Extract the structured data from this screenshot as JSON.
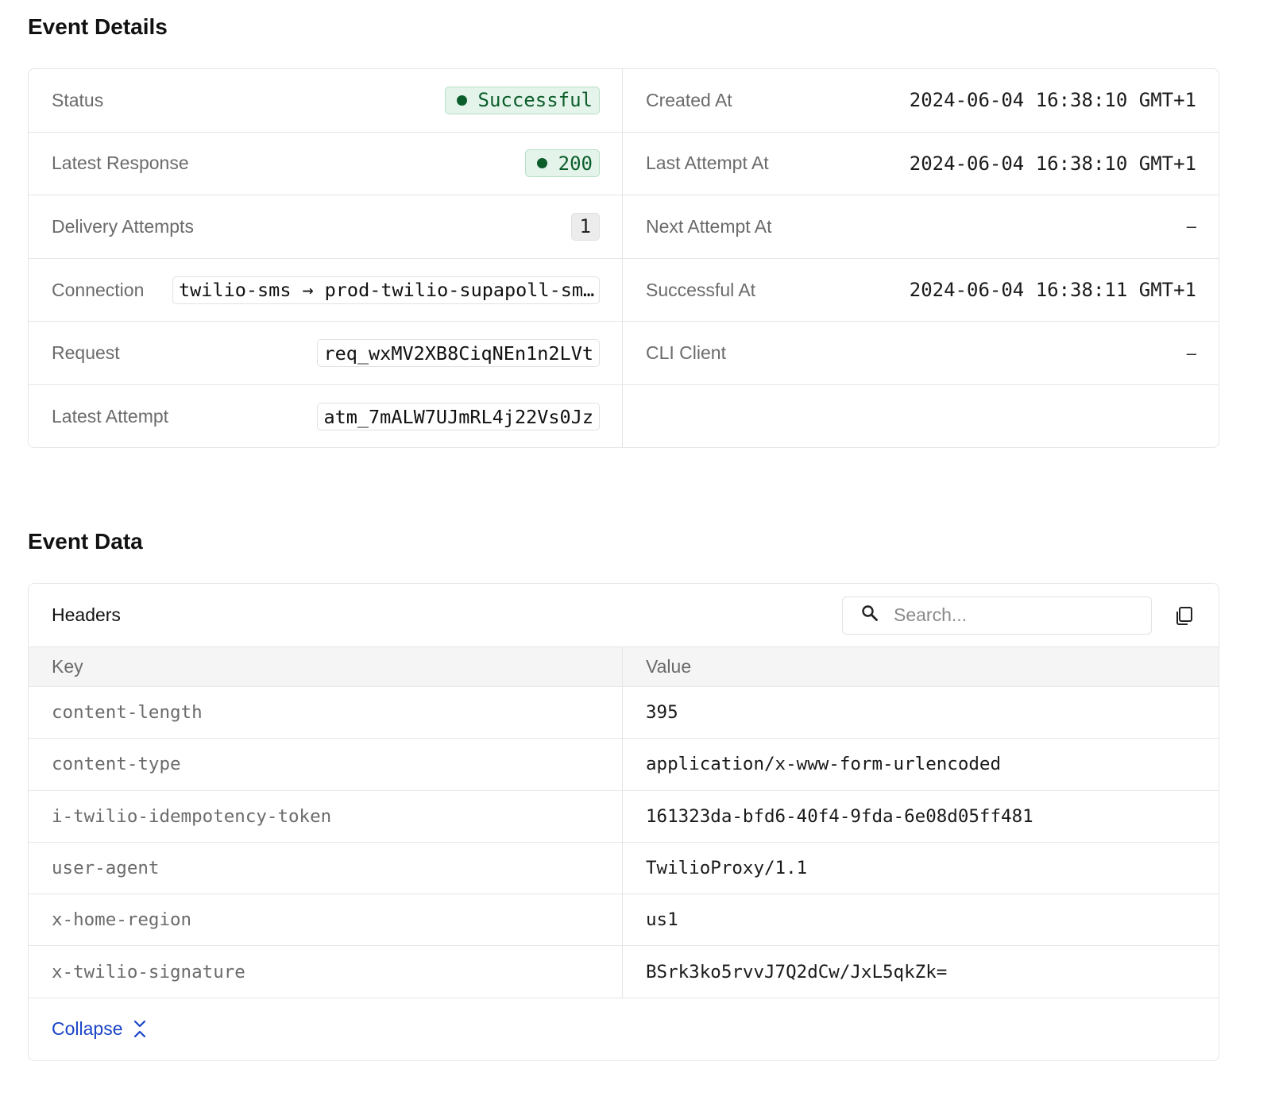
{
  "event_details": {
    "title": "Event Details",
    "left": [
      {
        "label": "Status",
        "value": "Successful",
        "kind": "success"
      },
      {
        "label": "Latest Response",
        "value": "200",
        "kind": "success"
      },
      {
        "label": "Delivery Attempts",
        "value": "1",
        "kind": "neutral"
      },
      {
        "label": "Connection",
        "source": "twilio-sms",
        "arrow": "→",
        "destination": "prod-twilio-supapoll-sm…",
        "kind": "connection"
      },
      {
        "label": "Request",
        "value": "req_wxMV2XB8CiqNEn1n2LVt",
        "kind": "chip"
      },
      {
        "label": "Latest Attempt",
        "value": "atm_7mALW7UJmRL4j22Vs0Jz",
        "kind": "chip"
      }
    ],
    "right": [
      {
        "label": "Created At",
        "value": "2024-06-04 16:38:10 GMT+1"
      },
      {
        "label": "Last Attempt At",
        "value": "2024-06-04 16:38:10 GMT+1"
      },
      {
        "label": "Next Attempt At",
        "value": "–"
      },
      {
        "label": "Successful At",
        "value": "2024-06-04 16:38:11 GMT+1"
      },
      {
        "label": "CLI Client",
        "value": "–"
      }
    ]
  },
  "event_data": {
    "title": "Event Data",
    "headers_title": "Headers",
    "search_placeholder": "Search...",
    "columns": {
      "key": "Key",
      "value": "Value"
    },
    "rows": [
      {
        "key": "content-length",
        "value": "395"
      },
      {
        "key": "content-type",
        "value": "application/x-www-form-urlencoded"
      },
      {
        "key": "i-twilio-idempotency-token",
        "value": "161323da-bfd6-40f4-9fda-6e08d05ff481"
      },
      {
        "key": "user-agent",
        "value": "TwilioProxy/1.1"
      },
      {
        "key": "x-home-region",
        "value": "us1"
      },
      {
        "key": "x-twilio-signature",
        "value": "BSrk3ko5rvvJ7Q2dCw/JxL5qkZk="
      }
    ],
    "collapse_label": "Collapse"
  },
  "colors": {
    "success_text": "#0b5d2a",
    "success_bg": "#e4f4ea",
    "link": "#1a44c7"
  },
  "icons": [
    "search-icon",
    "copy-icon",
    "collapse-chevrons-icon"
  ]
}
